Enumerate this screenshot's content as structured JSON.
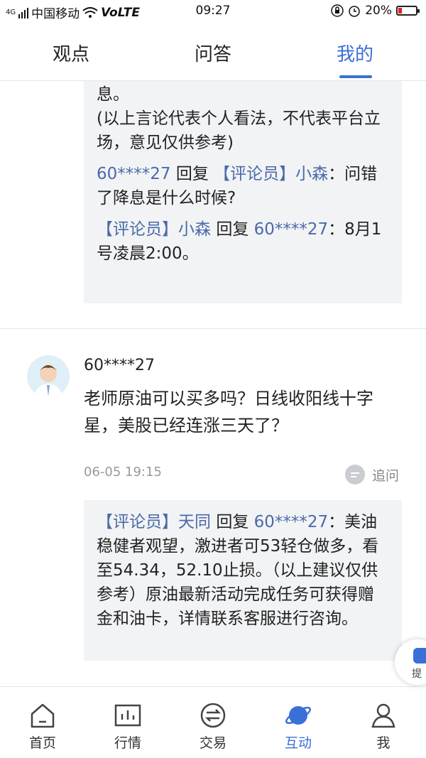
{
  "status_bar": {
    "network": "4G",
    "carrier": "中国移动",
    "volte": "VoLTE",
    "time": "09:27",
    "battery": "20%",
    "battery_level": 0.2,
    "battery_color": "#e02020"
  },
  "tabs": [
    {
      "label": "观点"
    },
    {
      "label": "问答"
    },
    {
      "label": "我的",
      "active": true
    }
  ],
  "accent_color": "#3a6fd8",
  "thread_prev": {
    "partial_line": "息。",
    "disclaimer": "(以上言论代表个人看法，不代表平台立场，意见仅供参考)",
    "reply1": {
      "from": "60****27",
      "verb": "回复",
      "to": "【评论员】小森",
      "text": "：问错了降息是什么时候?"
    },
    "reply2": {
      "from": "【评论员】小森",
      "verb": "回复",
      "to": "60****27",
      "text": "：8月1号凌晨2:00。"
    }
  },
  "question": {
    "username": "60****27",
    "text": "老师原油可以买多吗？日线收阳线十字星，美股已经连涨三天了？",
    "time": "06-05 19:15",
    "followup_label": "追问",
    "reply": {
      "from": "【评论员】天同",
      "verb": "回复",
      "to": "60****27",
      "text": "：美油稳健者观望，激进者可53轻仓做多，看至54.34，52.10止损。（以上建议仅供参考）原油最新活动完成任务可获得赠金和油卡，详情联系客服进行咨询。"
    }
  },
  "float_button": {
    "label": "提"
  },
  "bottom_nav": [
    {
      "label": "首页",
      "icon": "home-icon"
    },
    {
      "label": "行情",
      "icon": "chart-icon"
    },
    {
      "label": "交易",
      "icon": "exchange-icon"
    },
    {
      "label": "互动",
      "icon": "planet-icon",
      "active": true
    },
    {
      "label": "我",
      "icon": "person-icon"
    }
  ]
}
